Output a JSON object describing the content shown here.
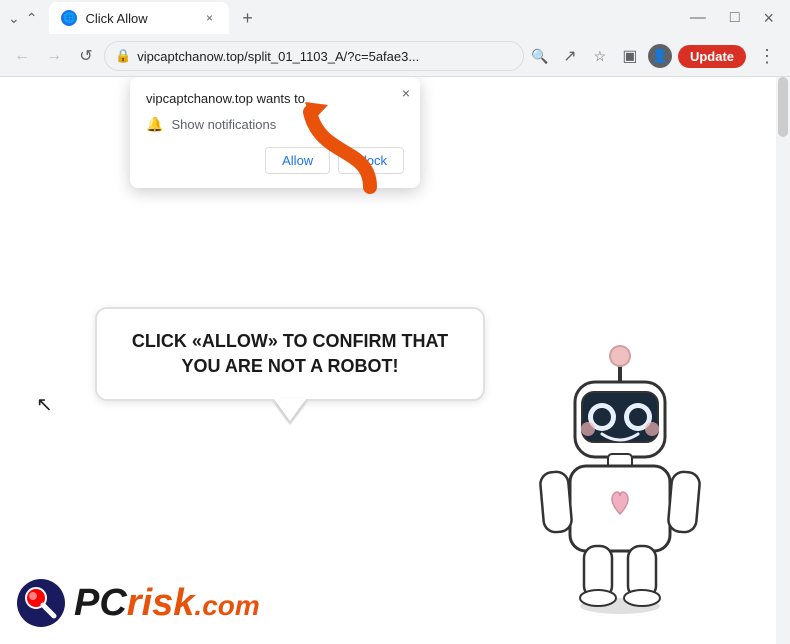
{
  "browser": {
    "tab": {
      "title": "Click Allow",
      "favicon": "🌐",
      "close": "×"
    },
    "window_controls": {
      "minimize": "—",
      "maximize": "□",
      "close": "×",
      "chevron_down": "⌄",
      "chevron_up": "⌃"
    },
    "address_bar": {
      "url": "vipcaptchanow.top/split_01_1103_A/?c=5afae3...",
      "lock_icon": "🔒"
    },
    "nav": {
      "back": "←",
      "forward": "→",
      "reload": "↺"
    },
    "toolbar": {
      "search_icon": "🔍",
      "share_icon": "↗",
      "bookmark_icon": "☆",
      "sidebar_icon": "▣",
      "profile_icon": "👤",
      "update_label": "Update",
      "menu_icon": "⋮"
    }
  },
  "notification_popup": {
    "site_text": "vipcaptchanow.top wants to",
    "permission_text": "Show notifications",
    "allow_label": "Allow",
    "block_label": "Block",
    "close_icon": "×"
  },
  "speech_bubble": {
    "text": "CLICK «ALLOW» TO CONFIRM THAT YOU ARE NOT A ROBOT!"
  },
  "pcrisk": {
    "pc_text": "PC",
    "risk_text": "risk",
    "com_text": ".com"
  },
  "colors": {
    "arrow": "#e8520a",
    "update_btn": "#d93025",
    "bubble_border": "#e0e0e0",
    "pcrisk_orange": "#e8520a"
  }
}
